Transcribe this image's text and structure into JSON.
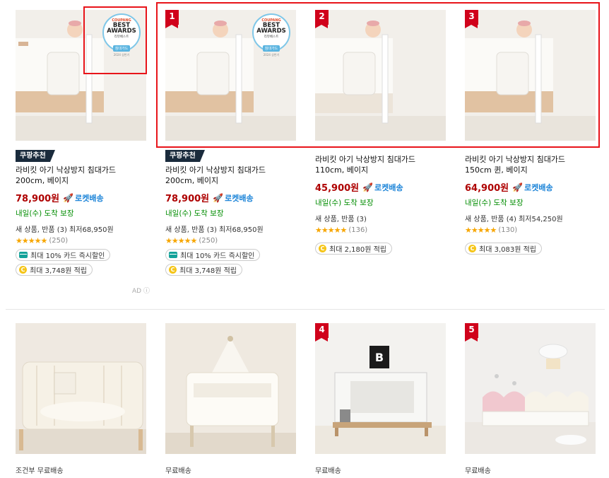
{
  "top_products": [
    {
      "rank": "",
      "badge": "쿠팡추천",
      "award": {
        "brand": "COUPANG",
        "line1": "BEST",
        "line2": "AWARDS",
        "sub": "리뷰베스트",
        "category": "침대가드",
        "year": "2024 상반기"
      },
      "title": "라비킷 아기 낙상방지 침대가드 200cm, 베이지",
      "price": "78,900원",
      "rocket": "로켓배송",
      "delivery": "내일(수) 도착 보장",
      "refurb": "새 상품, 반품 (3) 최저68,950원",
      "stars": "★★★★★",
      "reviews": "(250)",
      "card_discount": "최대 10% 카드 즉시할인",
      "cashback": "최대 3,748원 적립",
      "ad": "AD ⓘ"
    },
    {
      "rank": "1",
      "badge": "쿠팡추천",
      "award": {
        "brand": "COUPANG",
        "line1": "BEST",
        "line2": "AWARDS",
        "sub": "리뷰베스트",
        "category": "침대가드",
        "year": "2024 상반기"
      },
      "title": "라비킷 아기 낙상방지 침대가드 200cm, 베이지",
      "price": "78,900원",
      "rocket": "로켓배송",
      "delivery": "내일(수) 도착 보장",
      "refurb": "새 상품, 반품 (3) 최저68,950원",
      "stars": "★★★★★",
      "reviews": "(250)",
      "card_discount": "최대 10% 카드 즉시할인",
      "cashback": "최대 3,748원 적립"
    },
    {
      "rank": "2",
      "title": "라비킷 아기 낙상방지 침대가드 110cm, 베이지",
      "price": "45,900원",
      "rocket": "로켓배송",
      "delivery": "내일(수) 도착 보장",
      "refurb": "새 상품, 반품 (3)",
      "stars": "★★★★★",
      "reviews": "(136)",
      "cashback": "최대 2,180원 적립"
    },
    {
      "rank": "3",
      "title": "라비킷 아기 낙상방지 침대가드 150cm 퀸, 베이지",
      "price": "64,900원",
      "rocket": "로켓배송",
      "delivery": "내일(수) 도착 보장",
      "refurb": "새 상품, 반품 (4) 최저54,250원",
      "stars": "★★★★★",
      "reviews": "(130)",
      "cashback": "최대 3,083원 적립"
    }
  ],
  "bottom_products": [
    {
      "rank": "",
      "shipping": "조건부 무료배송"
    },
    {
      "rank": "",
      "shipping": "무료배송"
    },
    {
      "rank": "4",
      "shipping": "무료배송",
      "logo": "B"
    },
    {
      "rank": "5",
      "shipping": "무료배송"
    }
  ],
  "colors": {
    "accent_red": "#d0021b",
    "price_red": "#ae0000",
    "rocket_blue": "#1c84d8",
    "delivery_green": "#008c00"
  }
}
